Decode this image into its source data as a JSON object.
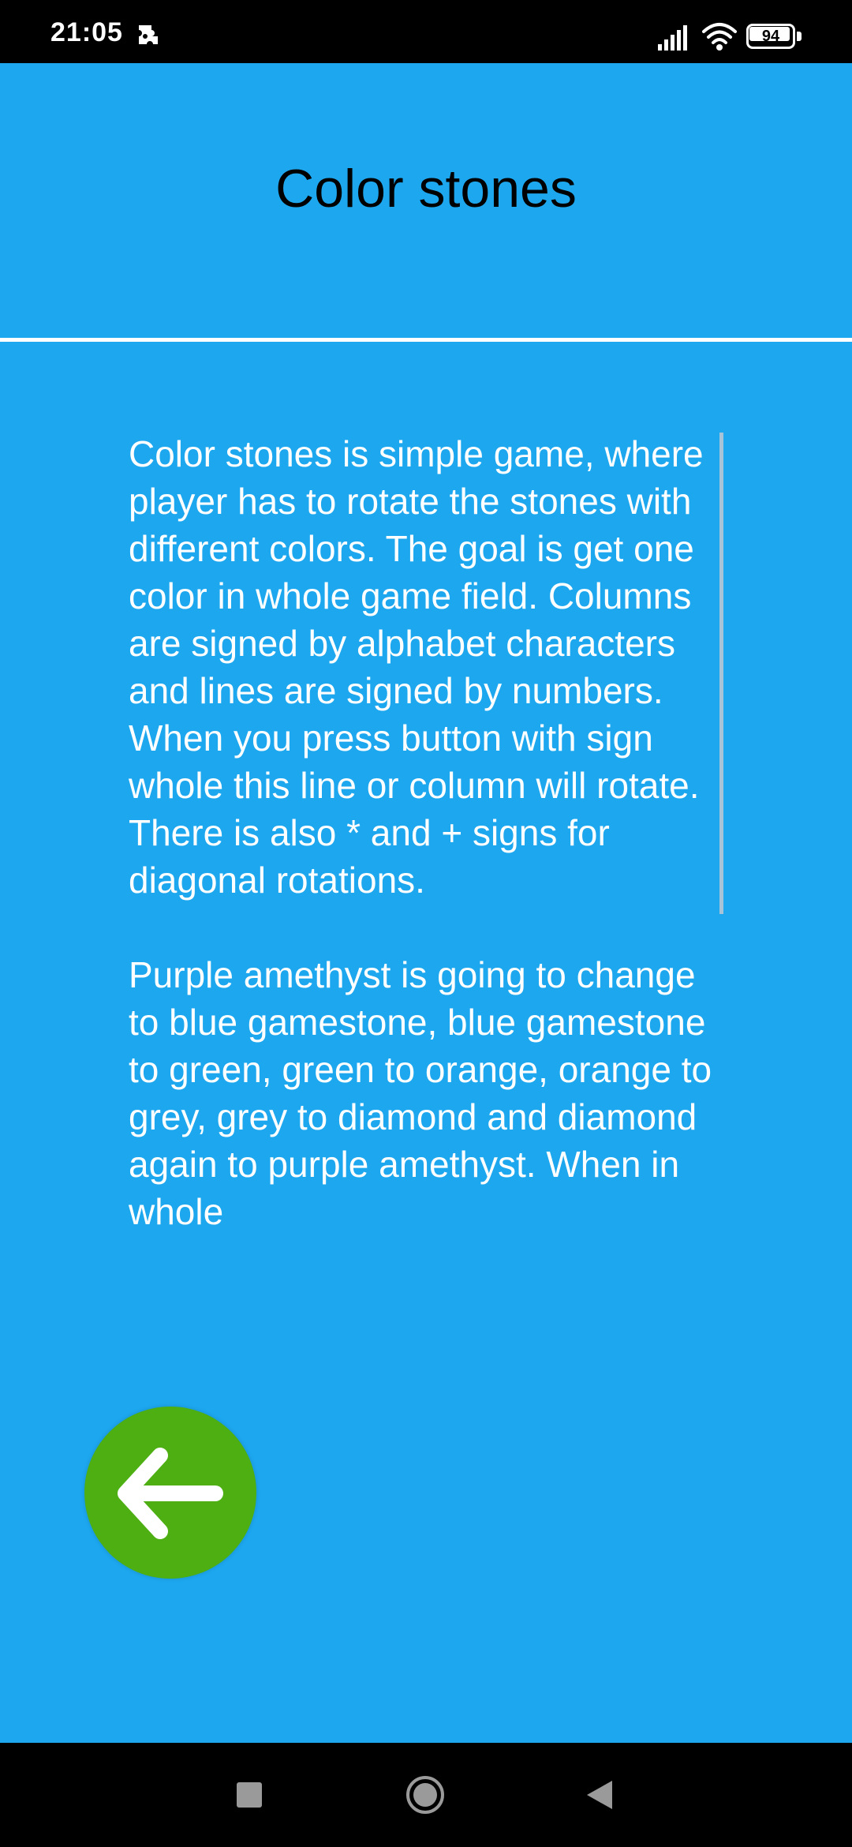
{
  "status_bar": {
    "time": "21:05",
    "battery_level": "94",
    "battery_fraction": 0.94,
    "app_icon": "puzzle-app-icon",
    "signal_icon": "cellular-signal-icon",
    "wifi_icon": "wifi-icon"
  },
  "header": {
    "title": "Color stones"
  },
  "description": {
    "paragraphs": [
      "Color stones is simple game, where player has to rotate the stones with different colors. The goal is get one color in whole game field. Columns are signed by alphabet characters and lines are signed by numbers. When you press button with sign whole this line or column will rotate. There is also * and + signs for diagonal rotations.",
      "Purple amethyst is going to change to blue gamestone, blue gamestone to green, green to orange, orange to grey, grey to diamond and diamond again to purple amethyst. When in whole"
    ]
  },
  "back_button": {
    "icon": "arrow-left-icon"
  },
  "nav_bar": {
    "recents_icon": "square-recents-icon",
    "home_icon": "circle-home-icon",
    "back_icon": "triangle-back-icon"
  },
  "colors": {
    "background": "#1DA7EF",
    "back_button": "#4DAF12",
    "text": "#FFFFFF",
    "title": "#000000",
    "bars": "#000000"
  }
}
